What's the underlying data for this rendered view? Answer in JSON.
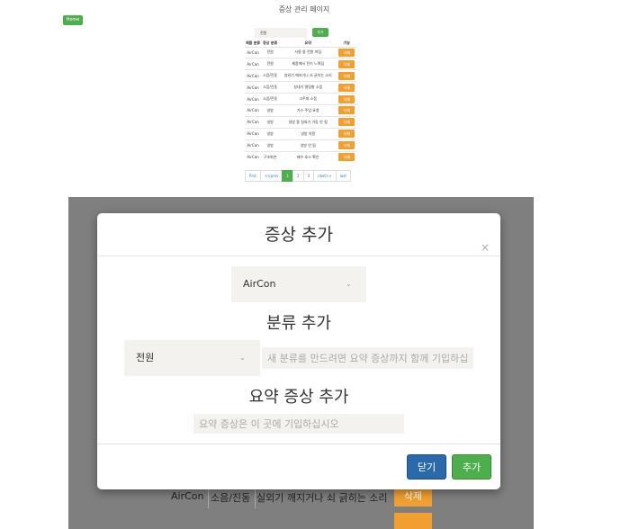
{
  "background": {
    "home_label": "Home",
    "title": "증상 관리 페이지",
    "filter": {
      "selected": "전원",
      "add_label": "추가"
    },
    "table": {
      "headers": [
        "제품 분류",
        "증상 분류",
        "요약",
        "기능"
      ],
      "rows": [
        [
          "AirCon",
          "전원",
          "사용 중 전원 꺼짐",
          "삭제"
        ],
        [
          "AirCon",
          "전원",
          "제품에서 전기 느껴짐",
          "삭제"
        ],
        [
          "AirCon",
          "소음/진동",
          "실외기 깨지거나 쇠 긁히는 소리",
          "삭제"
        ],
        [
          "AirCon",
          "소음/진동",
          "실내기 떨림형 소음",
          "삭제"
        ],
        [
          "AirCon",
          "소음/진동",
          "고주파 소음",
          "삭제"
        ],
        [
          "AirCon",
          "냉방",
          "가스 주입 요청",
          "삭제"
        ],
        [
          "AirCon",
          "냉방",
          "냉방 중 실외기 가동 안 됨",
          "삭제"
        ],
        [
          "AirCon",
          "냉방",
          "냉방 약함",
          "삭제"
        ],
        [
          "AirCon",
          "냉방",
          "냉방 안 됨",
          "삭제"
        ],
        [
          "AirCon",
          "구조파손",
          "배수 호스 확인",
          "삭제"
        ]
      ]
    },
    "pagination": [
      "first",
      "<<prev",
      "1",
      "2",
      "3",
      "next>>",
      "last"
    ],
    "active_page": "1",
    "visible_row": {
      "product": "AirCon",
      "category": "소음/진동",
      "summary": "실외기 깨지거나 쇠 긁히는 소리",
      "action": "삭제"
    }
  },
  "modal": {
    "title": "증상 추가",
    "close_icon": "×",
    "product_select": "AirCon",
    "category_title": "분류 추가",
    "category_select": "전원",
    "category_placeholder": "새 분류를 만드려면 요약 증상까지 함께 기입하십",
    "summary_title": "요약 증상 추가",
    "summary_placeholder": "요약 증상은 이 곳에 기입하십시오",
    "close_button": "닫기",
    "add_button": "추가"
  },
  "colors": {
    "primary": "#2a6aaa",
    "success": "#4cae4c",
    "warning": "#f0a030"
  }
}
